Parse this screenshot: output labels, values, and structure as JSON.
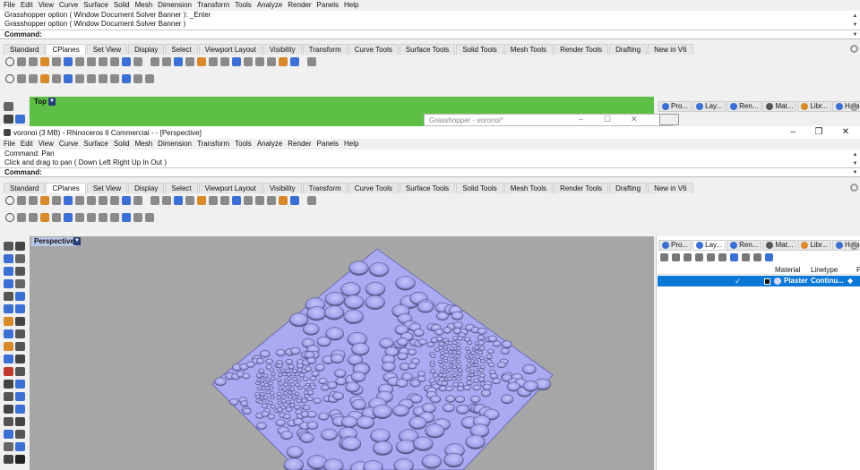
{
  "menu": [
    "File",
    "Edit",
    "View",
    "Curve",
    "Surface",
    "Solid",
    "Mesh",
    "Dimension",
    "Transform",
    "Tools",
    "Analyze",
    "Render",
    "Panels",
    "Help"
  ],
  "back": {
    "cmd_lines": [
      "Grasshopper option ( Window  Document  Solver  Banner ): _Enter",
      "Grasshopper option ( Window  Document  Solver  Banner )"
    ],
    "command_prompt": "Command:",
    "viewport_label": "Top",
    "grasshopper_title": "Grasshopper - voronoi*"
  },
  "front": {
    "window_title": "voronoi (3 MB) - Rhinoceros 6 Commercial - - [Perspective]",
    "cmd_lines": [
      "Command: Pan",
      "Click and drag to pan ( Down  Left  Right  Up  In  Out )"
    ],
    "command_prompt": "Command:",
    "viewport_label": "Perspective"
  },
  "tabs": [
    "Standard",
    "CPlanes",
    "Set View",
    "Display",
    "Select",
    "Viewport Layout",
    "Visibility",
    "Transform",
    "Curve Tools",
    "Surface Tools",
    "Solid Tools",
    "Mesh Tools",
    "Render Tools",
    "Drafting",
    "New in V6"
  ],
  "active_tab": "CPlanes",
  "panel_tabs": [
    "Pro...",
    "Lay...",
    "Ren...",
    "Mat...",
    "Libr...",
    "Help"
  ],
  "materials_table": {
    "headers": [
      "Material",
      "Linetype"
    ],
    "row": {
      "material": "Plaster",
      "linetype": "Continu..."
    }
  },
  "colors": {
    "top_viewport": "#5dbf45",
    "persp_bg": "#a6a6a6",
    "surface": "#aaaaf2",
    "selection": "#0a78d7"
  }
}
